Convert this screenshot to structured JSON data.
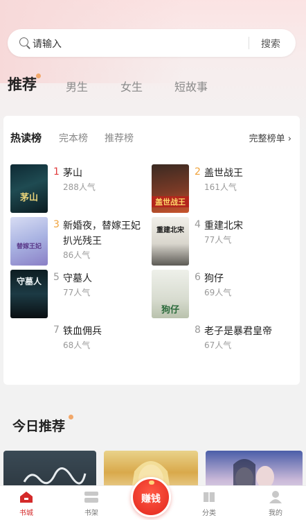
{
  "search": {
    "placeholder": "请输入",
    "button": "搜索"
  },
  "channels": [
    {
      "label": "推荐",
      "active": true
    },
    {
      "label": "男生",
      "active": false
    },
    {
      "label": "女生",
      "active": false
    },
    {
      "label": "短故事",
      "active": false
    }
  ],
  "ranking": {
    "tabs": [
      {
        "label": "热读榜",
        "active": true
      },
      {
        "label": "完本榜",
        "active": false
      },
      {
        "label": "推荐榜",
        "active": false
      }
    ],
    "full_link": "完整榜单 ›",
    "books": [
      {
        "rank": "1",
        "title": "茅山",
        "popularity": "288人气",
        "cover_text": "茅山"
      },
      {
        "rank": "2",
        "title": "盖世战王",
        "popularity": "161人气",
        "cover_text": "盖世战王"
      },
      {
        "rank": "3",
        "title": "新婚夜，替嫁王妃扒光残王",
        "popularity": "86人气",
        "cover_text": "替嫁王妃"
      },
      {
        "rank": "4",
        "title": "重建北宋",
        "popularity": "77人气",
        "cover_text": "重建北宋"
      },
      {
        "rank": "5",
        "title": "守墓人",
        "popularity": "77人气",
        "cover_text": "守墓人"
      },
      {
        "rank": "6",
        "title": "狗仔",
        "popularity": "69人气",
        "cover_text": "狗仔"
      },
      {
        "rank": "7",
        "title": "铁血佣兵",
        "popularity": "68人气",
        "cover_text": ""
      },
      {
        "rank": "8",
        "title": "老子是暴君皇帝",
        "popularity": "67人气",
        "cover_text": ""
      }
    ]
  },
  "today": {
    "title": "今日推荐"
  },
  "bottom_nav": [
    {
      "label": "书城",
      "icon": "home-icon",
      "active": true
    },
    {
      "label": "书架",
      "icon": "bookshelf-icon",
      "active": false
    },
    {
      "label": "赚钱",
      "icon": "red-envelope-icon",
      "active": false
    },
    {
      "label": "分类",
      "icon": "category-icon",
      "active": false
    },
    {
      "label": "我的",
      "icon": "user-icon",
      "active": false
    }
  ],
  "colors": {
    "accent": "#d42a2a",
    "rank_top": "#e0393a",
    "rank_gold": "#f0a23a",
    "dot": "#f2a86a"
  }
}
